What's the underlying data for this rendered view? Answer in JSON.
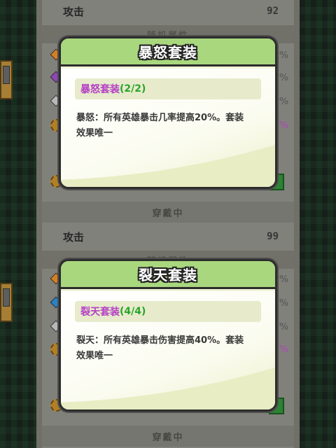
{
  "top_panel": {
    "attack_label": "攻击",
    "attack_value": "92",
    "section_label": "随机属性",
    "equipped_label": "穿戴中",
    "percents": [
      "%",
      "%",
      "%",
      "%"
    ]
  },
  "bottom_panel": {
    "attack_label": "攻击",
    "attack_value": "99",
    "section_label": "随机属性",
    "equipped_label": "穿戴中",
    "percents": [
      "%",
      "%",
      "%",
      "%"
    ]
  },
  "popup_1": {
    "title": "暴怒套装",
    "set_name": "暴怒套装",
    "set_count": "(2/2)",
    "description_line1": "暴怒：所有英雄暴击几率提高20%。套装",
    "description_line2": "效果唯一"
  },
  "popup_2": {
    "title": "裂天套装",
    "set_name": "裂天套装",
    "set_count": "(4/4)",
    "description_line1": "裂天：所有英雄暴击伤害提高40%。套装",
    "description_line2": "效果唯一"
  },
  "colors": {
    "header_green": "#a9d77e",
    "set_name_purple": "#b43fc4",
    "set_count_green": "#2aa52a"
  }
}
